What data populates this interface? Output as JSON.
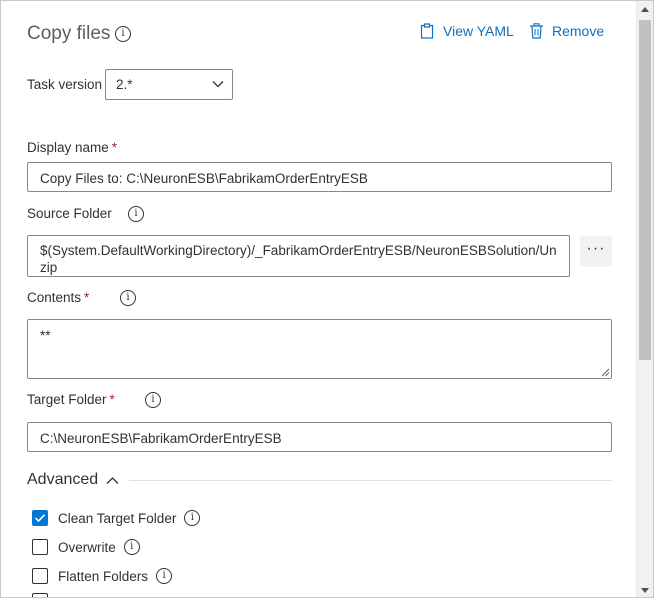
{
  "panel": {
    "title": "Copy files",
    "actions": {
      "view_yaml": "View YAML",
      "remove": "Remove"
    }
  },
  "task_version": {
    "label": "Task version",
    "value": "2.*"
  },
  "display_name": {
    "label": "Display name",
    "required": "*",
    "value": "Copy Files to: C:\\NeuronESB\\FabrikamOrderEntryESB"
  },
  "source_folder": {
    "label": "Source Folder",
    "value": "$(System.DefaultWorkingDirectory)/_FabrikamOrderEntryESB/NeuronESBSolution/Unzip",
    "more": "···"
  },
  "contents": {
    "label": "Contents",
    "required": "*",
    "value": "**"
  },
  "target_folder": {
    "label": "Target Folder",
    "required": "*",
    "value": "C:\\NeuronESB\\FabrikamOrderEntryESB"
  },
  "advanced": {
    "label": "Advanced",
    "options": [
      {
        "label": "Clean Target Folder",
        "checked": true
      },
      {
        "label": "Overwrite",
        "checked": false
      },
      {
        "label": "Flatten Folders",
        "checked": false
      }
    ]
  },
  "colors": {
    "accent": "#0078d4",
    "link": "#106ebe",
    "required": "#a4262c"
  }
}
